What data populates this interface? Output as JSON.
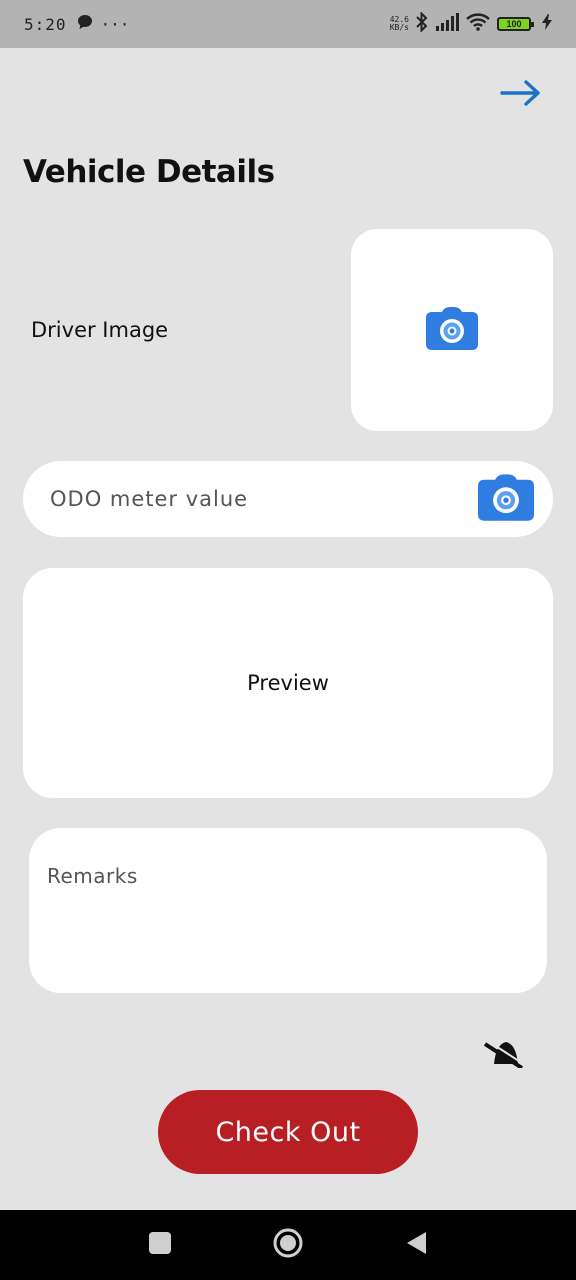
{
  "status_bar": {
    "time": "5:20",
    "more": "···",
    "net_speed_value": "42.6",
    "net_speed_unit": "KB/s",
    "battery_level": "100",
    "battery_color": "#7ed321"
  },
  "header": {
    "next_icon": "arrow-right-icon",
    "title": "Vehicle Details"
  },
  "driver_image": {
    "label": "Driver Image",
    "icon": "camera-icon"
  },
  "odo": {
    "placeholder": "ODO meter value",
    "icon": "camera-icon"
  },
  "preview": {
    "label": "Preview"
  },
  "remarks": {
    "placeholder": "Remarks"
  },
  "actions": {
    "checkout_label": "Check Out",
    "checkout_color": "#b81f24"
  },
  "nav": {
    "items": [
      "recents-icon",
      "home-icon",
      "back-icon"
    ]
  },
  "colors": {
    "background": "#e3e3e3",
    "accent_blue": "#1a73c8",
    "camera_blue": "#2f7de1"
  }
}
